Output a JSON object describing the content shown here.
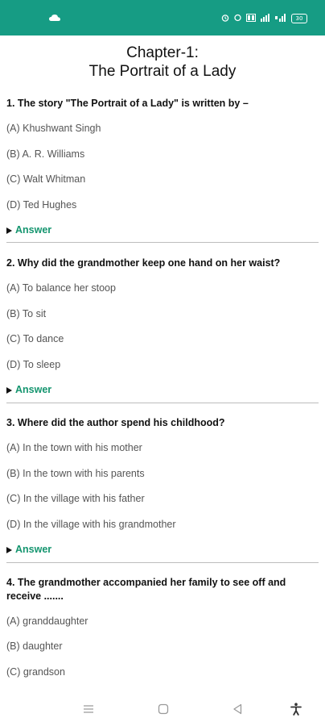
{
  "status_bar": {
    "left_icon": "cloud-icon",
    "right_icons": [
      "alarm-icon",
      "data-icon",
      "volte-icon",
      "signal-4g-icon",
      "signal-icon",
      "battery-icon"
    ],
    "battery_level": "30",
    "background_color": "#169c84"
  },
  "chapter": {
    "title_line1": "Chapter-1:",
    "title_line2": "The Portrait of a Lady"
  },
  "questions": [
    {
      "text": "1. The story \"The Portrait of a Lady\" is written by –",
      "options": [
        "(A) Khushwant Singh",
        "(B) A. R. Williams",
        "(C) Walt Whitman",
        "(D) Ted Hughes"
      ],
      "answer_label": "Answer"
    },
    {
      "text": "2. Why did the grandmother keep one hand on her waist?",
      "options": [
        "(A) To balance her stoop",
        "(B) To sit",
        "(C) To dance",
        "(D) To sleep"
      ],
      "answer_label": "Answer"
    },
    {
      "text": "3. Where did the author spend his childhood?",
      "options": [
        "(A) In the town with his mother",
        "(B) In the town with his parents",
        "(C) In the village with his father",
        "(D) In the village with his grandmother"
      ],
      "answer_label": "Answer"
    },
    {
      "text_line1": "4. The grandmother accompanied her family to see off and",
      "text_line2": "receive .......",
      "options": [
        "(A) granddaughter",
        "(B) daughter",
        "(C) grandson"
      ]
    }
  ],
  "nav_bar": {
    "icons": [
      "menu-icon",
      "home-icon",
      "back-icon",
      "accessibility-icon"
    ]
  },
  "accent_color": "#15956f"
}
